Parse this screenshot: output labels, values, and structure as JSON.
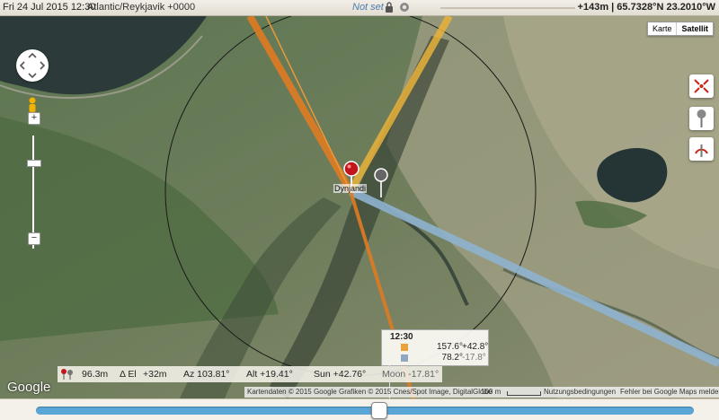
{
  "topbar": {
    "date_time": "Fri 24 Jul 2015 12:30",
    "timezone": "Atlantic/Reykjavik +0000",
    "location_status": "Not set",
    "elevation_coords": "+143m | 65.7328°N 23.2010°W"
  },
  "map": {
    "type_options": [
      "Karte",
      "Satellit"
    ],
    "selected_type": "Satellit",
    "place_label": "Dynjandi",
    "google_logo": "Google",
    "colors": {
      "sun_line": "#e07b22",
      "sun_line_light": "#e8b23a",
      "moon_line": "#8fb3cf",
      "pin_red": "#c0151b",
      "pin_grey": "#666666"
    }
  },
  "info_bar": {
    "distance": "96.3m",
    "delta_el": "Δ El",
    "delta_el_value": "+32m",
    "azimuth": "Az 103.81°",
    "altitude": "Alt +19.41°",
    "sun": "Sun +42.76°",
    "moon": "Moon -17.81°"
  },
  "popup": {
    "time": "12:30",
    "sun_azimuth": "157.6°",
    "sun_elevation": "+42.8°",
    "moon_azimuth": "78.2°",
    "moon_elevation": "-17.8°"
  },
  "credits": {
    "data": "Kartendaten © 2015 Google Grafiken © 2015 Cnes/Spot Image, DigitalGlobe",
    "scale": "100 m",
    "terms": "Nutzungsbedingungen",
    "report": "Fehler bei Google Maps melden"
  },
  "timeline": {
    "position_fraction": 0.52
  }
}
